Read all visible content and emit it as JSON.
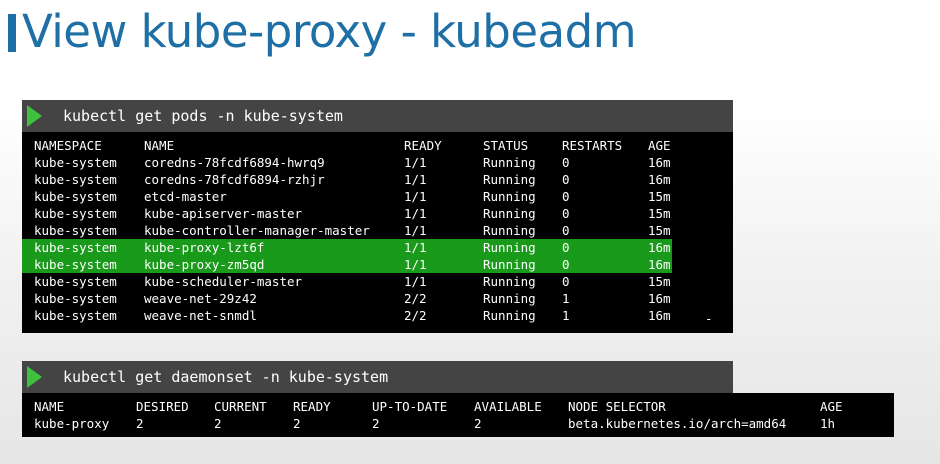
{
  "title": "View kube-proxy - kubeadm",
  "pods": {
    "command": "kubectl get pods -n kube-system",
    "columns": [
      "NAMESPACE",
      "NAME",
      "READY",
      "STATUS",
      "RESTARTS",
      "AGE"
    ],
    "rows": [
      [
        "kube-system",
        "coredns-78fcdf6894-hwrq9",
        "1/1",
        "Running",
        "0",
        "16m"
      ],
      [
        "kube-system",
        "coredns-78fcdf6894-rzhjr",
        "1/1",
        "Running",
        "0",
        "16m"
      ],
      [
        "kube-system",
        "etcd-master",
        "1/1",
        "Running",
        "0",
        "15m"
      ],
      [
        "kube-system",
        "kube-apiserver-master",
        "1/1",
        "Running",
        "0",
        "15m"
      ],
      [
        "kube-system",
        "kube-controller-manager-master",
        "1/1",
        "Running",
        "0",
        "15m"
      ],
      [
        "kube-system",
        "kube-proxy-lzt6f",
        "1/1",
        "Running",
        "0",
        "16m"
      ],
      [
        "kube-system",
        "kube-proxy-zm5qd",
        "1/1",
        "Running",
        "0",
        "16m"
      ],
      [
        "kube-system",
        "kube-scheduler-master",
        "1/1",
        "Running",
        "0",
        "15m"
      ],
      [
        "kube-system",
        "weave-net-29z42",
        "2/2",
        "Running",
        "1",
        "16m"
      ],
      [
        "kube-system",
        "weave-net-snmdl",
        "2/2",
        "Running",
        "1",
        "16m"
      ]
    ],
    "highlighted_rows": [
      5,
      6
    ],
    "trailing_mark": "-"
  },
  "daemonset": {
    "command": "kubectl get daemonset -n kube-system",
    "columns": [
      "NAME",
      "DESIRED",
      "CURRENT",
      "READY",
      "UP-TO-DATE",
      "AVAILABLE",
      "NODE SELECTOR",
      "AGE"
    ],
    "rows": [
      [
        "kube-proxy",
        "2",
        "2",
        "2",
        "2",
        "2",
        "beta.kubernetes.io/arch=amd64",
        "1h"
      ]
    ]
  },
  "colors": {
    "title": "#1d6fa5",
    "command_bar": "#444444",
    "play_icon": "#3ec23e",
    "terminal_bg": "#000000",
    "highlight": "#1a9a1a"
  }
}
